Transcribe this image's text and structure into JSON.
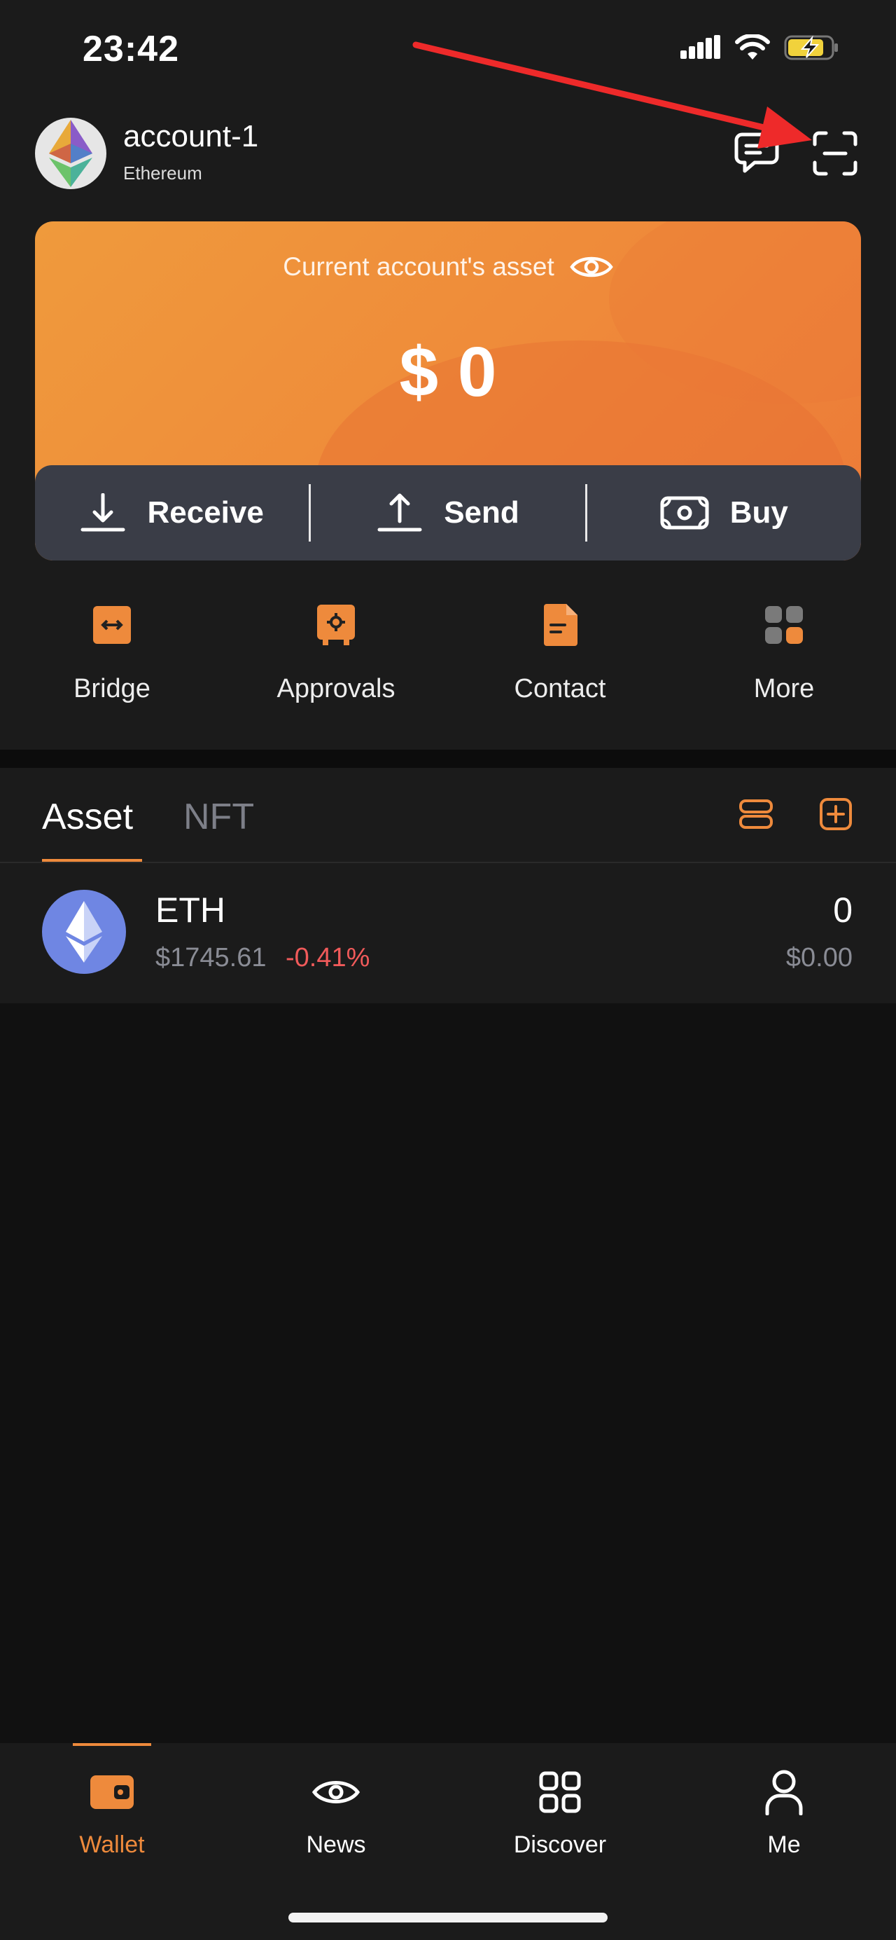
{
  "status_bar": {
    "time": "23:42"
  },
  "header": {
    "account_name": "account-1",
    "network": "Ethereum",
    "icons": [
      "chat-icon",
      "scan-icon"
    ]
  },
  "card": {
    "label": "Current account's asset",
    "amount": "$ 0",
    "actions": {
      "receive": "Receive",
      "send": "Send",
      "buy": "Buy"
    }
  },
  "quick_actions": [
    {
      "label": "Bridge",
      "icon": "bridge-icon"
    },
    {
      "label": "Approvals",
      "icon": "approvals-icon"
    },
    {
      "label": "Contact",
      "icon": "contact-icon"
    },
    {
      "label": "More",
      "icon": "more-icon"
    }
  ],
  "tabs": {
    "asset": "Asset",
    "nft": "NFT",
    "active": "Asset"
  },
  "tokens": [
    {
      "symbol": "ETH",
      "price": "$1745.61",
      "change": "-0.41%",
      "balance": "0",
      "value": "$0.00"
    }
  ],
  "bottom_nav": [
    {
      "label": "Wallet",
      "icon": "wallet-icon",
      "active": true
    },
    {
      "label": "News",
      "icon": "eye-icon",
      "active": false
    },
    {
      "label": "Discover",
      "icon": "grid-icon",
      "active": false
    },
    {
      "label": "Me",
      "icon": "person-icon",
      "active": false
    }
  ],
  "colors": {
    "accent": "#ee8a3c",
    "background": "#111111",
    "surface": "#1b1b1b",
    "negative": "#f05a5a",
    "card_actions": "#3a3d47"
  }
}
